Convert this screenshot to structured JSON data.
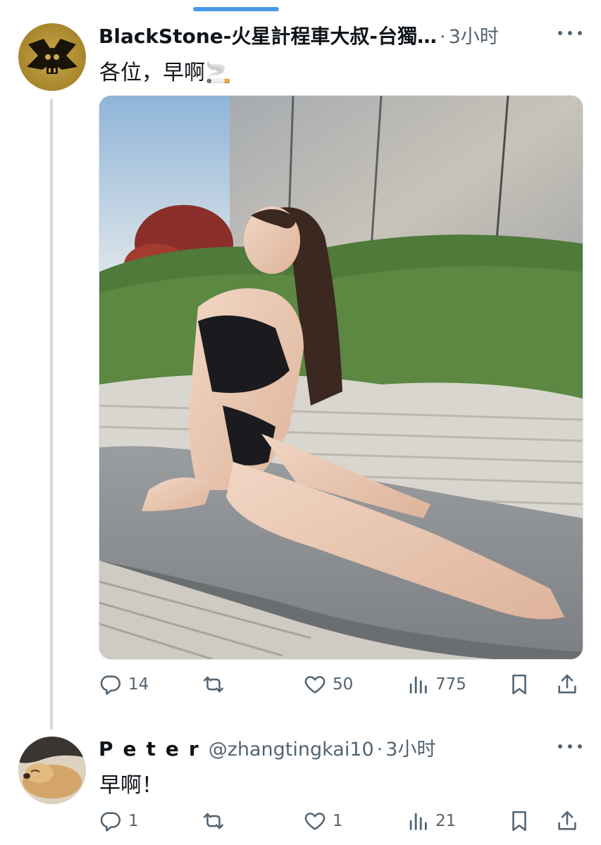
{
  "tweet1": {
    "author": "BlackStone-火星計程車大叔-台獨…",
    "separator": "·",
    "time": "3小时",
    "text": "各位，早啊🚬",
    "avatar_icon": "skull-crossed-bones-avatar",
    "image": "photo-woman-black-swimsuit-on-wicker-daybed",
    "replies": "14",
    "retweets": "",
    "likes": "50",
    "views": "775"
  },
  "tweet2": {
    "author": "Peter",
    "handle": "@zhangtingkai10",
    "separator": "·",
    "time": "3小时",
    "text": "早啊！",
    "avatar_icon": "sleeping-dog-avatar",
    "replies": "1",
    "retweets": "",
    "likes": "1",
    "views": "21"
  },
  "icons": {
    "reply": "reply-icon",
    "retweet": "retweet-icon",
    "like": "heart-icon",
    "views": "views-icon",
    "bookmark": "bookmark-icon",
    "share": "share-icon",
    "more": "more-icon"
  },
  "colors": {
    "text": "#0f1419",
    "secondary": "#536471",
    "thread_line": "#cfd9de",
    "accent": "#4a99e9"
  }
}
